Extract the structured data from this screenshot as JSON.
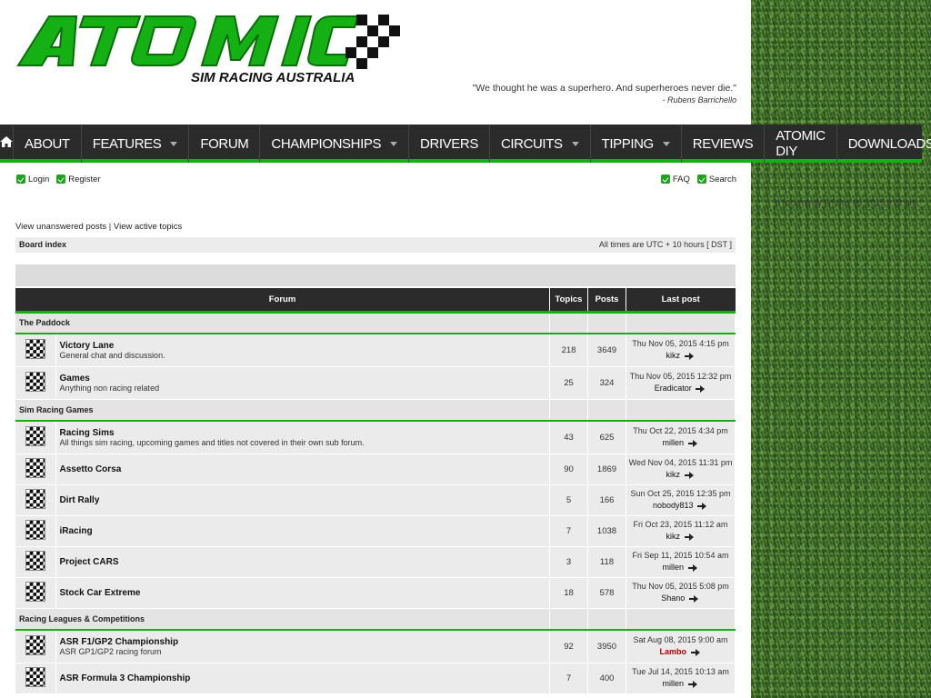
{
  "brand": {
    "name": "ATOMIC",
    "tagline": "SIM RACING AUSTRALIA",
    "accent": "#14b014"
  },
  "quote": {
    "text": "\"We thought he was a superhero. And superheroes never die.\"",
    "author": "- Rubens Barrichello"
  },
  "nav": [
    {
      "label": "ABOUT",
      "dropdown": false
    },
    {
      "label": "FEATURES",
      "dropdown": true
    },
    {
      "label": "FORUM",
      "dropdown": false
    },
    {
      "label": "CHAMPIONSHIPS",
      "dropdown": true
    },
    {
      "label": "DRIVERS",
      "dropdown": false
    },
    {
      "label": "CIRCUITS",
      "dropdown": true
    },
    {
      "label": "TIPPING",
      "dropdown": true
    },
    {
      "label": "REVIEWS",
      "dropdown": false
    },
    {
      "label": "ATOMIC DIY",
      "dropdown": false
    },
    {
      "label": "DOWNLOADS",
      "dropdown": true
    }
  ],
  "topbar": {
    "login": "Login",
    "register": "Register",
    "faq": "FAQ",
    "search": "Search"
  },
  "current_time": "It is currently Fri Nov 06, 2015 6:22 am",
  "quicklinks": {
    "unanswered": "View unanswered posts",
    "separator": " | ",
    "active": "View active topics"
  },
  "breadcrumb": {
    "board_index": "Board index",
    "timezone": "All times are UTC + 10 hours [ DST ]"
  },
  "table_headers": {
    "forum": "Forum",
    "topics": "Topics",
    "posts": "Posts",
    "last_post": "Last post"
  },
  "categories": [
    {
      "name": "The Paddock",
      "forums": [
        {
          "title": "Victory Lane",
          "desc": "General chat and discussion.",
          "topics": "218",
          "posts": "3649",
          "last_date": "Thu Nov 05, 2015 4:15 pm",
          "last_user": "kikz",
          "user_color": ""
        },
        {
          "title": "Games",
          "desc": "Anything non racing related",
          "topics": "25",
          "posts": "324",
          "last_date": "Thu Nov 05, 2015 12:32 pm",
          "last_user": "Eradicator",
          "user_color": ""
        }
      ]
    },
    {
      "name": "Sim Racing Games",
      "forums": [
        {
          "title": "Racing Sims",
          "desc": "All things sim racing, upcoming games and titles not covered in their own sub forum.",
          "topics": "43",
          "posts": "625",
          "last_date": "Thu Oct 22, 2015 4:34 pm",
          "last_user": "millen",
          "user_color": ""
        },
        {
          "title": "Assetto Corsa",
          "desc": "",
          "topics": "90",
          "posts": "1869",
          "last_date": "Wed Nov 04, 2015 11:31 pm",
          "last_user": "kikz",
          "user_color": ""
        },
        {
          "title": "Dirt Rally",
          "desc": "",
          "topics": "5",
          "posts": "166",
          "last_date": "Sun Oct 25, 2015 12:35 pm",
          "last_user": "nobody813",
          "user_color": ""
        },
        {
          "title": "iRacing",
          "desc": "",
          "topics": "7",
          "posts": "1038",
          "last_date": "Fri Oct 23, 2015 11:12 am",
          "last_user": "kikz",
          "user_color": ""
        },
        {
          "title": "Project CARS",
          "desc": "",
          "topics": "3",
          "posts": "118",
          "last_date": "Fri Sep 11, 2015 10:54 am",
          "last_user": "millen",
          "user_color": ""
        },
        {
          "title": "Stock Car Extreme",
          "desc": "",
          "topics": "18",
          "posts": "578",
          "last_date": "Thu Nov 05, 2015 5:08 pm",
          "last_user": "Shano",
          "user_color": ""
        }
      ]
    },
    {
      "name": "Racing Leagues & Competitions",
      "forums": [
        {
          "title": "ASR F1/GP2 Championship",
          "desc": "ASR GP1/GP2 racing forum",
          "topics": "92",
          "posts": "3950",
          "last_date": "Sat Aug 08, 2015 9:00 am",
          "last_user": "Lambo",
          "user_color": "#b80000"
        },
        {
          "title": "ASR Formula 3 Championship",
          "desc": "",
          "topics": "7",
          "posts": "400",
          "last_date": "Tue Jul 14, 2015 10:13 am",
          "last_user": "millen",
          "user_color": ""
        }
      ]
    }
  ]
}
